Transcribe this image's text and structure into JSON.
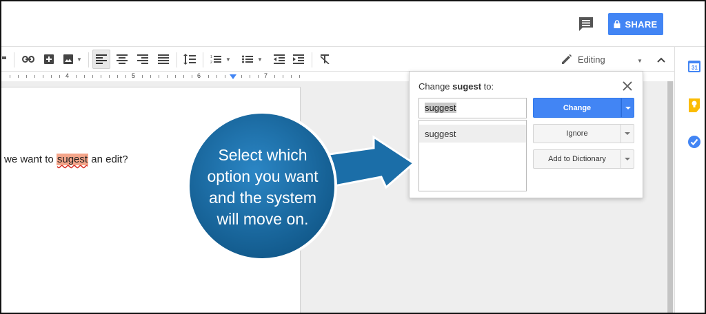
{
  "header": {
    "share_label": "SHARE",
    "comments_icon": "comment-icon",
    "lock_icon": "lock-icon"
  },
  "toolbar": {
    "items": [
      "paint-format-icon",
      "link-icon",
      "insert-comment-icon",
      "image-icon",
      "align-left-icon",
      "align-center-icon",
      "align-right-icon",
      "align-justify-icon",
      "line-spacing-icon",
      "numbered-list-icon",
      "bulleted-list-icon",
      "decrease-indent-icon",
      "increase-indent-icon",
      "clear-formatting-icon"
    ],
    "mode_label": "Editing"
  },
  "ruler": {
    "numbers": [
      "4",
      "5",
      "6",
      "7"
    ]
  },
  "document": {
    "before": "we want to ",
    "misspelled_word": "sugest",
    "after": " an edit?"
  },
  "spellcheck": {
    "title_prefix": "Change ",
    "title_word": "sugest",
    "title_suffix": " to:",
    "input_value": "suggest",
    "suggestions": [
      "suggest"
    ],
    "change_label": "Change",
    "ignore_label": "Ignore",
    "add_dictionary_label": "Add to Dictionary"
  },
  "callout": {
    "lines": [
      "Select which",
      "option you want",
      "and the system",
      "will move on."
    ]
  },
  "colors": {
    "accent": "#4285f4",
    "callout": "#1b6ea8",
    "highlight": "#f4a58a"
  }
}
